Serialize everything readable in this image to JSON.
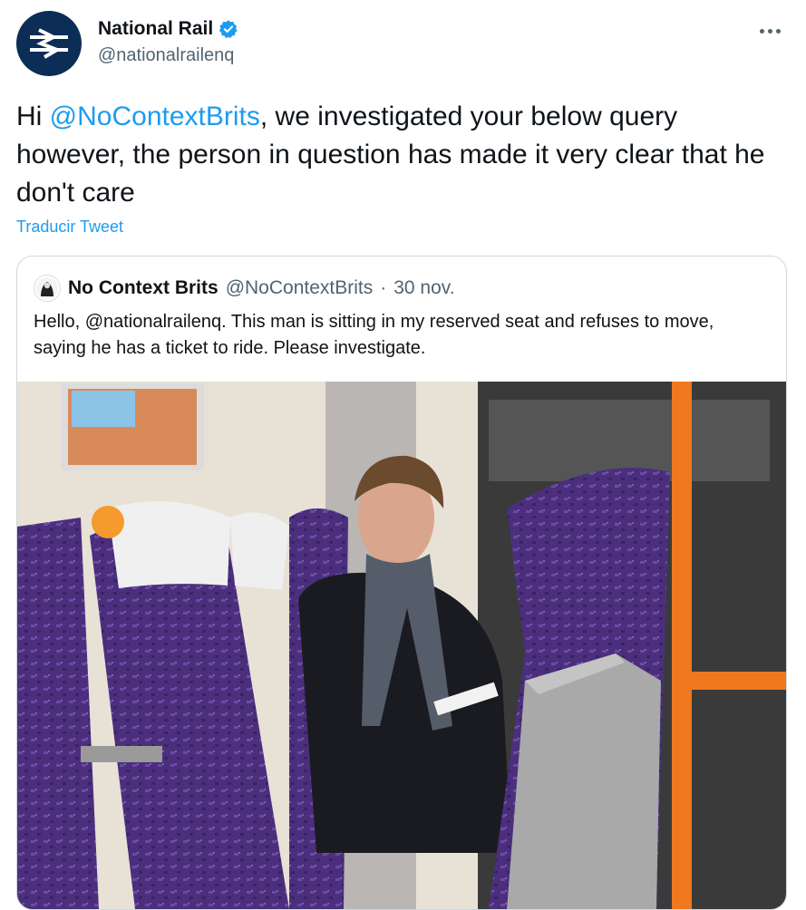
{
  "author": {
    "name": "National Rail",
    "handle": "@nationalrailenq",
    "avatar_icon": "national-rail-logo-icon",
    "verified_icon": "verified-badge-icon"
  },
  "tweet": {
    "text_prefix": "Hi ",
    "mention": "@NoContextBrits",
    "text_suffix": ", we investigated your below query however, the person in question has made it very clear that he don't care",
    "translate_label": "Traducir Tweet"
  },
  "quoted_tweet": {
    "name": "No Context Brits",
    "handle": "@NoContextBrits",
    "separator": "·",
    "date": "30 nov.",
    "text": "Hello, @nationalrailenq. This man is sitting in my reserved seat and refuses to move, saying he has a ticket to ride. Please investigate.",
    "media_icon": "train-interior-photo"
  },
  "colors": {
    "accent": "#1d9bf0",
    "text": "#0f1419",
    "muted": "#536471",
    "border": "#cfd9de",
    "rail_navy": "#0b2d56",
    "seat_purple": "#4a2f7a",
    "pole_orange": "#f0781e"
  }
}
